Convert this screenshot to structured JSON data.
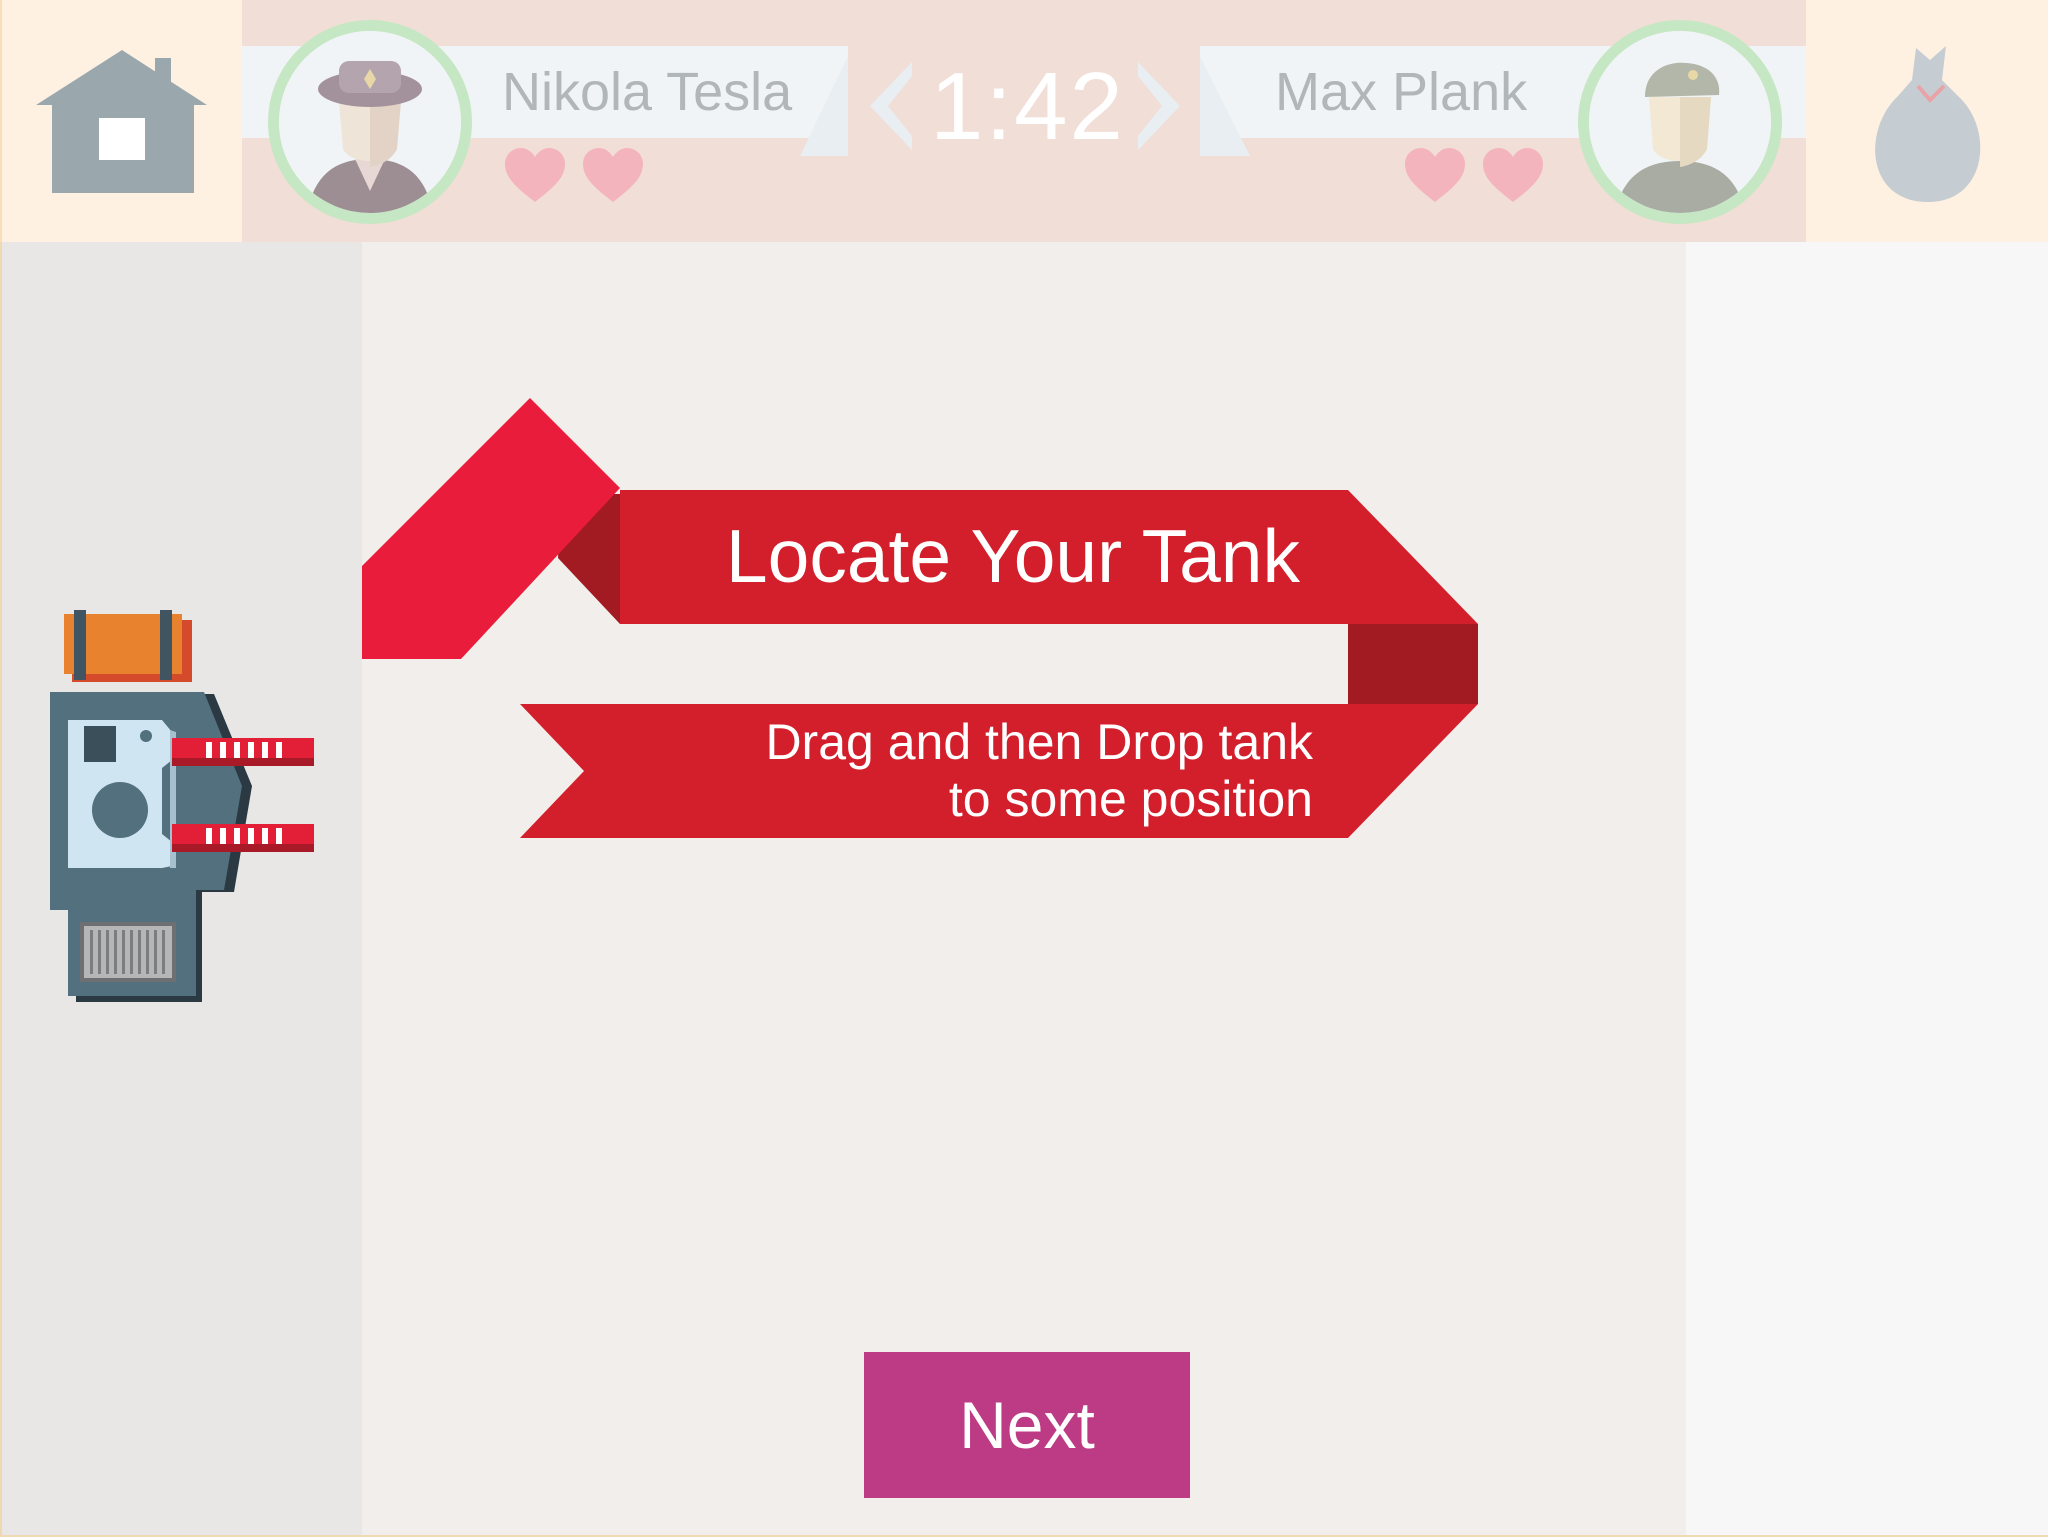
{
  "header": {
    "home_icon": "house-icon",
    "bag_icon": "money-bag-icon",
    "timer": "1:42"
  },
  "players": [
    {
      "name": "Nikola Tesla",
      "avatar_icon": "officer-avatar-icon",
      "lives": 2
    },
    {
      "name": "Max Plank",
      "avatar_icon": "soldier-avatar-icon",
      "lives": 2
    }
  ],
  "banner": {
    "title": "Locate Your Tank",
    "subtitle_line1": "Drag and then Drop tank",
    "subtitle_line2": "to some position"
  },
  "buttons": {
    "next_label": "Next"
  },
  "colors": {
    "ribbon_red": "#d31f2b",
    "ribbon_dark": "#a31b22",
    "ribbon_bright": "#e91c3b",
    "button": "#bd3b84",
    "avatar_ring": "#c6e7c3",
    "heart": "#f4b4be"
  },
  "tank_icon": "tank-icon"
}
